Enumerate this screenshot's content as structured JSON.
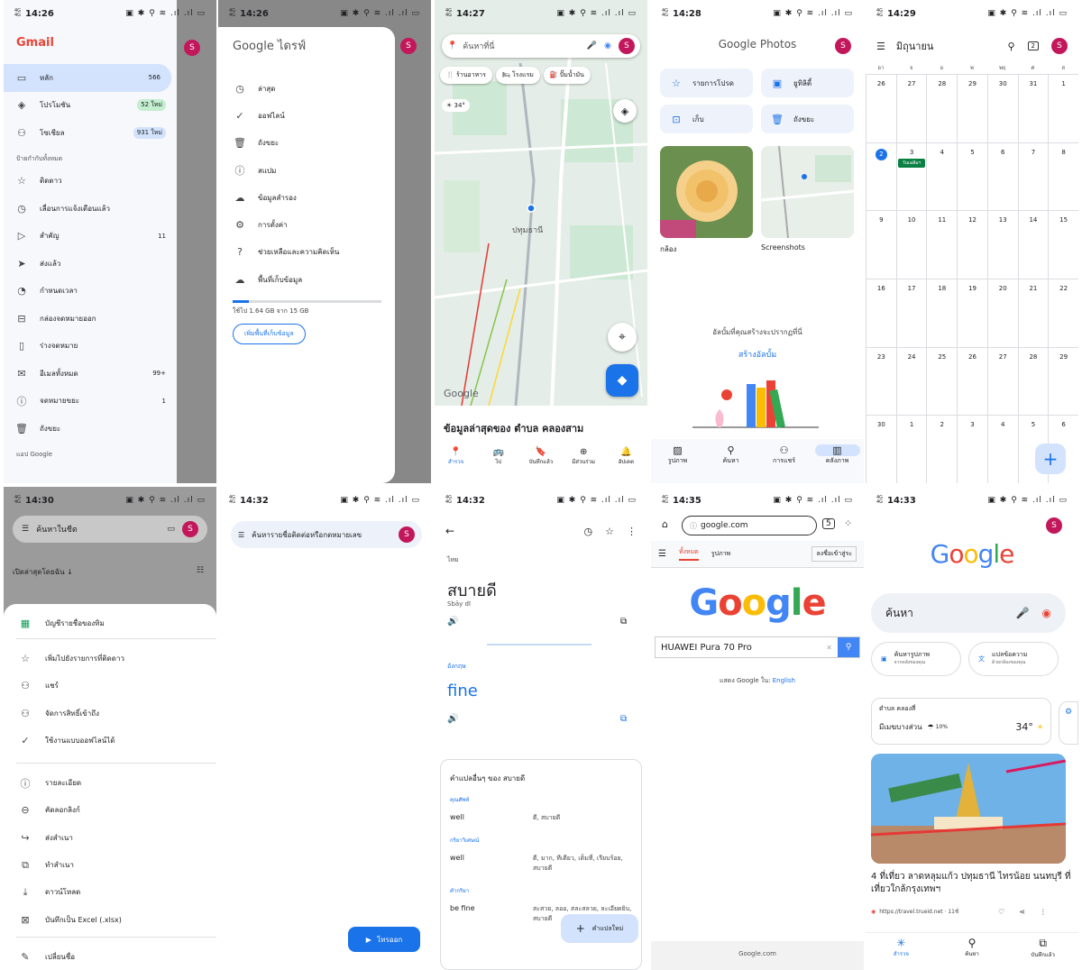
{
  "status": {
    "net": "4G\n4G",
    "icons": "▣ ✱ ⚲ ≋ .ıl .ıl ▭",
    "times": [
      "14:26",
      "14:26",
      "14:27",
      "14:28",
      "14:29",
      "14:30",
      "14:32",
      "14:32",
      "14:35",
      "14:33"
    ]
  },
  "avatar": "S",
  "gmail": {
    "logo": "Gmail",
    "items": [
      {
        "icon": "▭",
        "label": "หลัก",
        "count": "566"
      },
      {
        "icon": "◈",
        "label": "โปรโมชัน",
        "badge": "52 ใหม่",
        "badge_color": "#c4eed0"
      },
      {
        "icon": "⚇",
        "label": "โซเชียล",
        "badge": "931 ใหม่",
        "badge_color": "#d3e3fd"
      }
    ],
    "section": "ป้ายกำกับทั้งหมด",
    "labels": [
      {
        "icon": "☆",
        "label": "ติดดาว",
        "count": ""
      },
      {
        "icon": "◷",
        "label": "เลื่อนการแจ้งเตือนแล้ว",
        "count": ""
      },
      {
        "icon": "▷",
        "label": "สำคัญ",
        "count": "11"
      },
      {
        "icon": "➤",
        "label": "ส่งแล้ว",
        "count": ""
      },
      {
        "icon": "◔",
        "label": "กำหนดเวลา",
        "count": ""
      },
      {
        "icon": "⊟",
        "label": "กล่องจดหมายออก",
        "count": ""
      },
      {
        "icon": "▯",
        "label": "ร่างจดหมาย",
        "count": ""
      },
      {
        "icon": "✉",
        "label": "อีเมลทั้งหมด",
        "count": "99+"
      },
      {
        "icon": "ⓘ",
        "label": "จดหมายขยะ",
        "count": "1"
      },
      {
        "icon": "🗑",
        "label": "ถังขยะ",
        "count": ""
      }
    ],
    "footer": "แอป Google"
  },
  "drive": {
    "logo_google": "Google",
    "logo_drive": " ไดรฟ์",
    "items": [
      {
        "icon": "◷",
        "label": "ล่าสุด"
      },
      {
        "icon": "✓",
        "label": "ออฟไลน์"
      },
      {
        "icon": "🗑",
        "label": "ถังขยะ"
      },
      {
        "icon": "ⓘ",
        "label": "สแปม"
      },
      {
        "icon": "☁",
        "label": "ข้อมูลสำรอง"
      },
      {
        "icon": "⚙",
        "label": "การตั้งค่า"
      },
      {
        "icon": "?",
        "label": "ช่วยเหลือและความคิดเห็น"
      },
      {
        "icon": "☁",
        "label": "พื้นที่เก็บข้อมูล"
      }
    ],
    "storage_used_fraction": 0.11,
    "storage_text": "ใช้ไป 1.64 GB จาก 15 GB",
    "buy_button": "เพิ่มพื้นที่เก็บข้อมูล"
  },
  "maps": {
    "search_placeholder": "ค้นหาที่นี่",
    "chips": [
      {
        "icon": "🍴",
        "label": "ร้านอาหาร"
      },
      {
        "icon": "🛏",
        "label": "โรงแรม"
      },
      {
        "icon": "⛽",
        "label": "ปั๊มน้ำมัน"
      }
    ],
    "weather": "34°",
    "place_label": "ปทุมธานี",
    "road_numbers": [
      "3214",
      "3111",
      "346",
      "345",
      "3312",
      "302",
      "305"
    ],
    "watermark": "Google",
    "sheet_title": "ข้อมูลล่าสุดของ ตำบล คลองสาม",
    "nav": [
      {
        "icon": "📍",
        "label": "สำรวจ"
      },
      {
        "icon": "🚌",
        "label": "ไป"
      },
      {
        "icon": "🔖",
        "label": "บันทึกแล้ว"
      },
      {
        "icon": "⊕",
        "label": "มีส่วนร่วม"
      },
      {
        "icon": "🔔",
        "label": "อัปเดต"
      }
    ]
  },
  "photos": {
    "logo_google": "Google",
    "logo_photos": " Photos",
    "tiles": [
      {
        "icon": "☆",
        "label": "รายการโปรด"
      },
      {
        "icon": "▣",
        "label": "ยูทิลิตี้"
      },
      {
        "icon": "⊡",
        "label": "เก็บ"
      },
      {
        "icon": "🗑",
        "label": "ถังขยะ"
      }
    ],
    "albums": [
      "กล้อง",
      "Screenshots"
    ],
    "empty_text": "อัลบั้มที่คุณสร้างจะปรากฏที่นี่",
    "create_link": "สร้างอัลบั้ม",
    "nav": [
      {
        "icon": "▨",
        "label": "รูปภาพ"
      },
      {
        "icon": "⚲",
        "label": "ค้นหา"
      },
      {
        "icon": "⚇",
        "label": "การแชร์"
      },
      {
        "icon": "▥",
        "label": "คลังภาพ"
      }
    ]
  },
  "calendar": {
    "month": "มิถุนายน",
    "dow": [
      "อา",
      "จ",
      "อ",
      "พ",
      "พฤ",
      "ศ",
      "ส"
    ],
    "days": [
      "26",
      "27",
      "28",
      "29",
      "30",
      "31",
      "1",
      "2",
      "3",
      "4",
      "5",
      "6",
      "7",
      "8",
      "9",
      "10",
      "11",
      "12",
      "13",
      "14",
      "15",
      "16",
      "17",
      "18",
      "19",
      "20",
      "21",
      "22",
      "23",
      "24",
      "25",
      "26",
      "27",
      "28",
      "29",
      "30",
      "1",
      "2",
      "3",
      "4",
      "5",
      "6"
    ],
    "today_index": 7,
    "event": {
      "day_index": 8,
      "label": "วันเฉลิมฯ"
    },
    "add_button": "+"
  },
  "sheets": {
    "search": "ค้นหาในชีต",
    "recent": "เปิดล่าสุดโดยฉัน ↓",
    "title": "บัญชีรายชื่อของทิม",
    "items_a": [
      {
        "icon": "☆",
        "label": "เพิ่มไปยังรายการที่ติดดาว"
      },
      {
        "icon": "⚇",
        "label": "แชร์"
      },
      {
        "icon": "⚇",
        "label": "จัดการสิทธิ์เข้าถึง"
      },
      {
        "icon": "✓",
        "label": "ใช้งานแบบออฟไลน์ได้"
      }
    ],
    "items_b": [
      {
        "icon": "ⓘ",
        "label": "รายละเอียด"
      },
      {
        "icon": "⊖",
        "label": "คัดลอกลิงก์"
      },
      {
        "icon": "↪",
        "label": "ส่งสำเนา"
      },
      {
        "icon": "⧉",
        "label": "ทำสำเนา"
      },
      {
        "icon": "⤓",
        "label": "ดาวน์โหลด"
      },
      {
        "icon": "⊠",
        "label": "บันทึกเป็น Excel (.xlsx)"
      }
    ],
    "rename": {
      "icon": "✎",
      "label": "เปลี่ยนชื่อ"
    }
  },
  "contacts": {
    "search": "ค้นหารายชื่อติดต่อหรือกดหมายเลข",
    "fab": "โทรออก"
  },
  "translate": {
    "src_lang": "ไทย",
    "src_word": "สบายดี",
    "romanization": "Sbāy dī",
    "tgt_lang": "อังกฤษ",
    "tgt_word": "fine",
    "card_title": "คำแปลอื่นๆ ของ สบายดี",
    "groups": [
      {
        "pos": "คุณศัพท์",
        "rows": [
          {
            "a": "well",
            "b": "ดี, สบายดี"
          }
        ]
      },
      {
        "pos": "กริยาวิเศษณ์",
        "rows": [
          {
            "a": "well",
            "b": "ดี, มาก, ทีเดียว, เต็มที่, เรียบร้อย, สบายดี"
          }
        ]
      },
      {
        "pos": "คำกริยา",
        "rows": [
          {
            "a": "be fine",
            "b": "สะสวย, ลออ, สละสลวย, ละเอียดยิบ, สบายดี"
          }
        ]
      }
    ],
    "fab": "คำแปลใหม่"
  },
  "browser": {
    "url": "google.com",
    "tabs": [
      "ทั้งหมด",
      "รูปภาพ"
    ],
    "signin": "ลงชื่อเข้าสู่ระ",
    "query": "HUAWEI Pura 70 Pro",
    "offered_in": "แสดง Google ใน:",
    "offered_lang": "English",
    "footer": "Google.com"
  },
  "google_app": {
    "search": "ค้นหา",
    "pills": [
      {
        "icon": "▣",
        "l1": "ค้นหารูปภาพ",
        "l2": "จากคลังของคุณ"
      },
      {
        "icon": "文",
        "l1": "แปลข้อความ",
        "l2": "ด้วยกล้องของคุณ"
      }
    ],
    "weather_place": "ตำบล คลองสี่",
    "weather_desc": "มีเมฆบางส่วน",
    "rain": "10%",
    "temp": "34°",
    "headline": "4 ที่เที่ยว ลาดหลุมแก้ว ปทุมธานี ไทรน้อย นนทบุรี ที่เที่ยวใกล้กรุงเทพฯ",
    "source": "https://travel.trueid.net · 11ชั่",
    "nav": [
      {
        "icon": "✳",
        "label": "สำรวจ"
      },
      {
        "icon": "⚲",
        "label": "ค้นหา"
      },
      {
        "icon": "⧉",
        "label": "บันทึกแล้ว"
      }
    ]
  },
  "colors": {
    "g_blue": "#4285f4",
    "g_red": "#ea4335",
    "g_yellow": "#fbbc05",
    "g_green": "#34a853",
    "accent": "#1a73e8",
    "avatar": "#c2185b"
  }
}
